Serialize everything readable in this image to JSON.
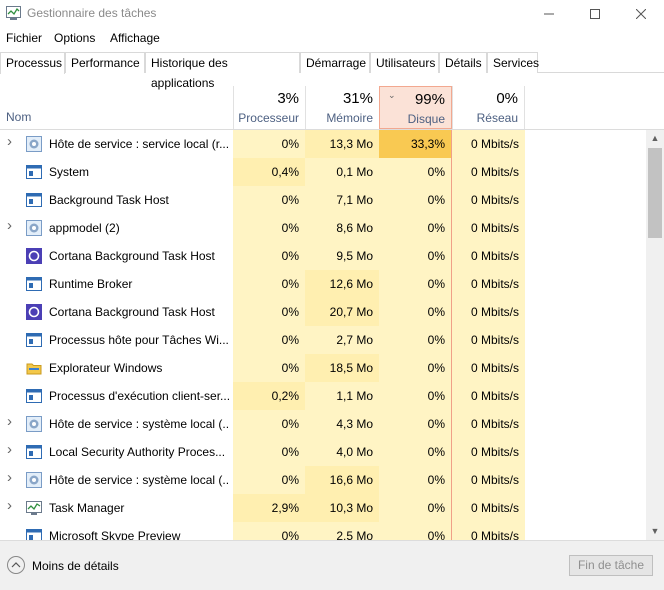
{
  "window": {
    "title": "Gestionnaire des tâches"
  },
  "menu": [
    "Fichier",
    "Options",
    "Affichage"
  ],
  "tabs": [
    "Processus",
    "Performance",
    "Historique des applications",
    "Démarrage",
    "Utilisateurs",
    "Détails",
    "Services"
  ],
  "active_tab": "Processus",
  "columns": {
    "name": "Nom",
    "cpu": {
      "pct": "3%",
      "label": "Processeur"
    },
    "mem": {
      "pct": "31%",
      "label": "Mémoire"
    },
    "disk": {
      "pct": "99%",
      "label": "Disque"
    },
    "net": {
      "pct": "0%",
      "label": "Réseau"
    }
  },
  "rows": [
    {
      "name": "Hôte de service : service local (r...",
      "icon": "gear-icon",
      "expandable": true,
      "cpu": "0%",
      "mem": "13,3 Mo",
      "disk": "33,3%",
      "net": "0 Mbits/s"
    },
    {
      "name": "System",
      "icon": "window-icon",
      "expandable": false,
      "cpu": "0,4%",
      "mem": "0,1 Mo",
      "disk": "0%",
      "net": "0 Mbits/s"
    },
    {
      "name": "Background Task Host",
      "icon": "window-icon",
      "expandable": false,
      "cpu": "0%",
      "mem": "7,1 Mo",
      "disk": "0%",
      "net": "0 Mbits/s"
    },
    {
      "name": "appmodel (2)",
      "icon": "gear-icon",
      "expandable": true,
      "cpu": "0%",
      "mem": "8,6 Mo",
      "disk": "0%",
      "net": "0 Mbits/s"
    },
    {
      "name": "Cortana Background Task Host",
      "icon": "cortana-icon",
      "expandable": false,
      "cpu": "0%",
      "mem": "9,5 Mo",
      "disk": "0%",
      "net": "0 Mbits/s"
    },
    {
      "name": "Runtime Broker",
      "icon": "window-icon",
      "expandable": false,
      "cpu": "0%",
      "mem": "12,6 Mo",
      "disk": "0%",
      "net": "0 Mbits/s"
    },
    {
      "name": "Cortana Background Task Host",
      "icon": "cortana-icon",
      "expandable": false,
      "cpu": "0%",
      "mem": "20,7 Mo",
      "disk": "0%",
      "net": "0 Mbits/s"
    },
    {
      "name": "Processus hôte pour Tâches Wi...",
      "icon": "window-icon",
      "expandable": false,
      "cpu": "0%",
      "mem": "2,7 Mo",
      "disk": "0%",
      "net": "0 Mbits/s"
    },
    {
      "name": "Explorateur Windows",
      "icon": "folder-icon",
      "expandable": false,
      "cpu": "0%",
      "mem": "18,5 Mo",
      "disk": "0%",
      "net": "0 Mbits/s"
    },
    {
      "name": "Processus d'exécution client-ser...",
      "icon": "window-icon",
      "expandable": false,
      "cpu": "0,2%",
      "mem": "1,1 Mo",
      "disk": "0%",
      "net": "0 Mbits/s"
    },
    {
      "name": "Hôte de service : système local (...",
      "icon": "gear-icon",
      "expandable": true,
      "cpu": "0%",
      "mem": "4,3 Mo",
      "disk": "0%",
      "net": "0 Mbits/s"
    },
    {
      "name": "Local Security Authority Proces...",
      "icon": "window-icon",
      "expandable": true,
      "cpu": "0%",
      "mem": "4,0 Mo",
      "disk": "0%",
      "net": "0 Mbits/s"
    },
    {
      "name": "Hôte de service : système local (...",
      "icon": "gear-icon",
      "expandable": true,
      "cpu": "0%",
      "mem": "16,6 Mo",
      "disk": "0%",
      "net": "0 Mbits/s"
    },
    {
      "name": "Task Manager",
      "icon": "task-manager-icon",
      "expandable": true,
      "cpu": "2,9%",
      "mem": "10,3 Mo",
      "disk": "0%",
      "net": "0 Mbits/s"
    },
    {
      "name": "Microsoft Skype Preview",
      "icon": "window-icon",
      "expandable": false,
      "cpu": "0%",
      "mem": "2,5 Mo",
      "disk": "0%",
      "net": "0 Mbits/s"
    }
  ],
  "footer": {
    "less_details": "Moins de détails",
    "end_task": "Fin de tâche"
  }
}
